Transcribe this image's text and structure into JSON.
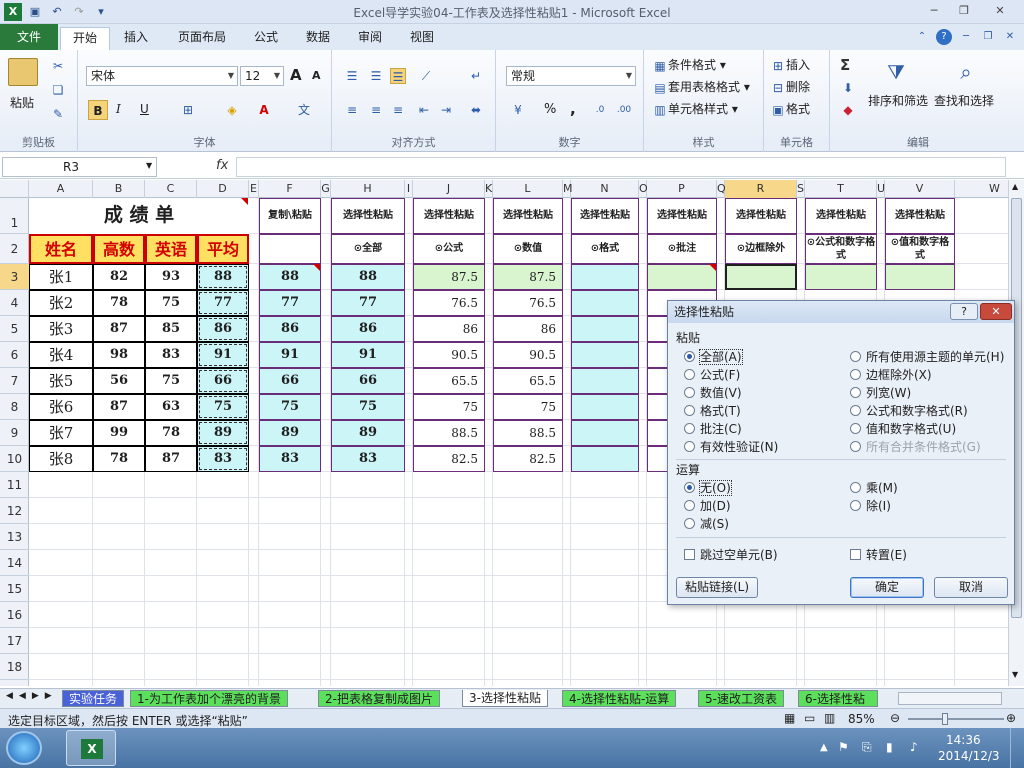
{
  "window": {
    "title": "Excel导学实验04-工作表及选择性粘贴1  -  Microsoft Excel"
  },
  "quick_access": [
    "save-icon",
    "undo-icon",
    "redo-icon",
    "customize-icon"
  ],
  "ribbon_tabs": [
    "文件",
    "开始",
    "插入",
    "页面布局",
    "公式",
    "数据",
    "审阅",
    "视图"
  ],
  "ribbon": {
    "clipboard": {
      "label": "剪贴板",
      "paste": "粘贴"
    },
    "font": {
      "label": "字体",
      "name": "宋体",
      "size": "12",
      "grow": "A",
      "shrink": "A",
      "bold": "B",
      "italic": "I",
      "underline": "U"
    },
    "alignment": {
      "label": "对齐方式"
    },
    "number": {
      "label": "数字",
      "format": "常规",
      "percent": "%",
      "comma": ","
    },
    "styles": {
      "label": "样式",
      "conditional": "条件格式",
      "table": "套用表格格式",
      "cell": "单元格样式"
    },
    "cells": {
      "label": "单元格",
      "insert": "插入",
      "delete": "删除",
      "format": "格式"
    },
    "editing": {
      "label": "编辑",
      "sort": "排序和筛选",
      "find": "查找和选择",
      "sigma": "Σ"
    }
  },
  "formula_bar": {
    "name_box": "R3",
    "fx": "fx",
    "content": ""
  },
  "columns": [
    "A",
    "B",
    "C",
    "D",
    "E",
    "F",
    "G",
    "H",
    "I",
    "J",
    "K",
    "L",
    "M",
    "N",
    "O",
    "P",
    "Q",
    "R",
    "S",
    "T",
    "U",
    "V",
    "W"
  ],
  "rows": [
    "1",
    "2",
    "3",
    "4",
    "5",
    "6",
    "7",
    "8",
    "9",
    "10",
    "11",
    "12",
    "13",
    "14",
    "15",
    "16",
    "17",
    "18"
  ],
  "sheet": {
    "title": "成 绩 单",
    "headers": [
      "姓名",
      "高数",
      "英语",
      "平均"
    ],
    "students": [
      {
        "name": "张1",
        "math": "82",
        "eng": "93",
        "avg": "88"
      },
      {
        "name": "张2",
        "math": "78",
        "eng": "75",
        "avg": "77"
      },
      {
        "name": "张3",
        "math": "87",
        "eng": "85",
        "avg": "86"
      },
      {
        "name": "张4",
        "math": "98",
        "eng": "83",
        "avg": "91"
      },
      {
        "name": "张5",
        "math": "56",
        "eng": "75",
        "avg": "66"
      },
      {
        "name": "张6",
        "math": "87",
        "eng": "63",
        "avg": "75"
      },
      {
        "name": "张7",
        "math": "99",
        "eng": "78",
        "avg": "89"
      },
      {
        "name": "张8",
        "math": "78",
        "eng": "87",
        "avg": "83"
      }
    ],
    "paste_titles": {
      "F": "复制\\粘贴",
      "H": "选择性粘贴",
      "J": "选择性粘贴",
      "L": "选择性粘贴",
      "N": "选择性粘贴",
      "P": "选择性粘贴",
      "R": "选择性粘贴",
      "T": "选择性粘贴",
      "V": "选择性粘贴"
    },
    "paste_subtitles": {
      "H": "⊙全部",
      "J": "⊙公式",
      "L": "⊙数值",
      "N": "⊙格式",
      "P": "⊙批注",
      "R": "⊙边框除外",
      "T": "⊙公式和数字格式",
      "V": "⊙值和数字格式"
    },
    "col_F": [
      "88",
      "77",
      "86",
      "91",
      "66",
      "75",
      "89",
      "83"
    ],
    "col_H": [
      "88",
      "77",
      "86",
      "91",
      "66",
      "75",
      "89",
      "83"
    ],
    "col_J": [
      "87.5",
      "76.5",
      "86",
      "90.5",
      "65.5",
      "75",
      "88.5",
      "82.5"
    ],
    "col_L": [
      "87.5",
      "76.5",
      "86",
      "90.5",
      "65.5",
      "75",
      "88.5",
      "82.5"
    ]
  },
  "sheet_tabs": [
    "实验任务",
    "1-为工作表加个漂亮的背景",
    "2-把表格复制成图片",
    "3-选择性粘贴",
    "4-选择性粘贴-运算",
    "5-速改工资表",
    "6-选择性粘"
  ],
  "active_sheet": "3-选择性粘贴",
  "status": {
    "message": "选定目标区域，然后按 ENTER 或选择“粘贴”",
    "zoom": "85%"
  },
  "taskbar": {
    "time": "14:36",
    "date": "2014/12/3"
  },
  "dialog": {
    "title": "选择性粘贴",
    "help": "?",
    "close": "✕",
    "paste_section": "粘贴",
    "paste_left": [
      "全部(A)",
      "公式(F)",
      "数值(V)",
      "格式(T)",
      "批注(C)",
      "有效性验证(N)"
    ],
    "paste_right": [
      "所有使用源主题的单元(H)",
      "边框除外(X)",
      "列宽(W)",
      "公式和数字格式(R)",
      "值和数字格式(U)",
      "所有合并条件格式(G)"
    ],
    "paste_selected": "全部(A)",
    "op_section": "运算",
    "op_left": [
      "无(O)",
      "加(D)",
      "减(S)"
    ],
    "op_right": [
      "乘(M)",
      "除(I)"
    ],
    "op_selected": "无(O)",
    "skip_blanks": "跳过空单元(B)",
    "transpose": "转置(E)",
    "paste_link": "粘贴链接(L)",
    "ok": "确定",
    "cancel": "取消"
  }
}
